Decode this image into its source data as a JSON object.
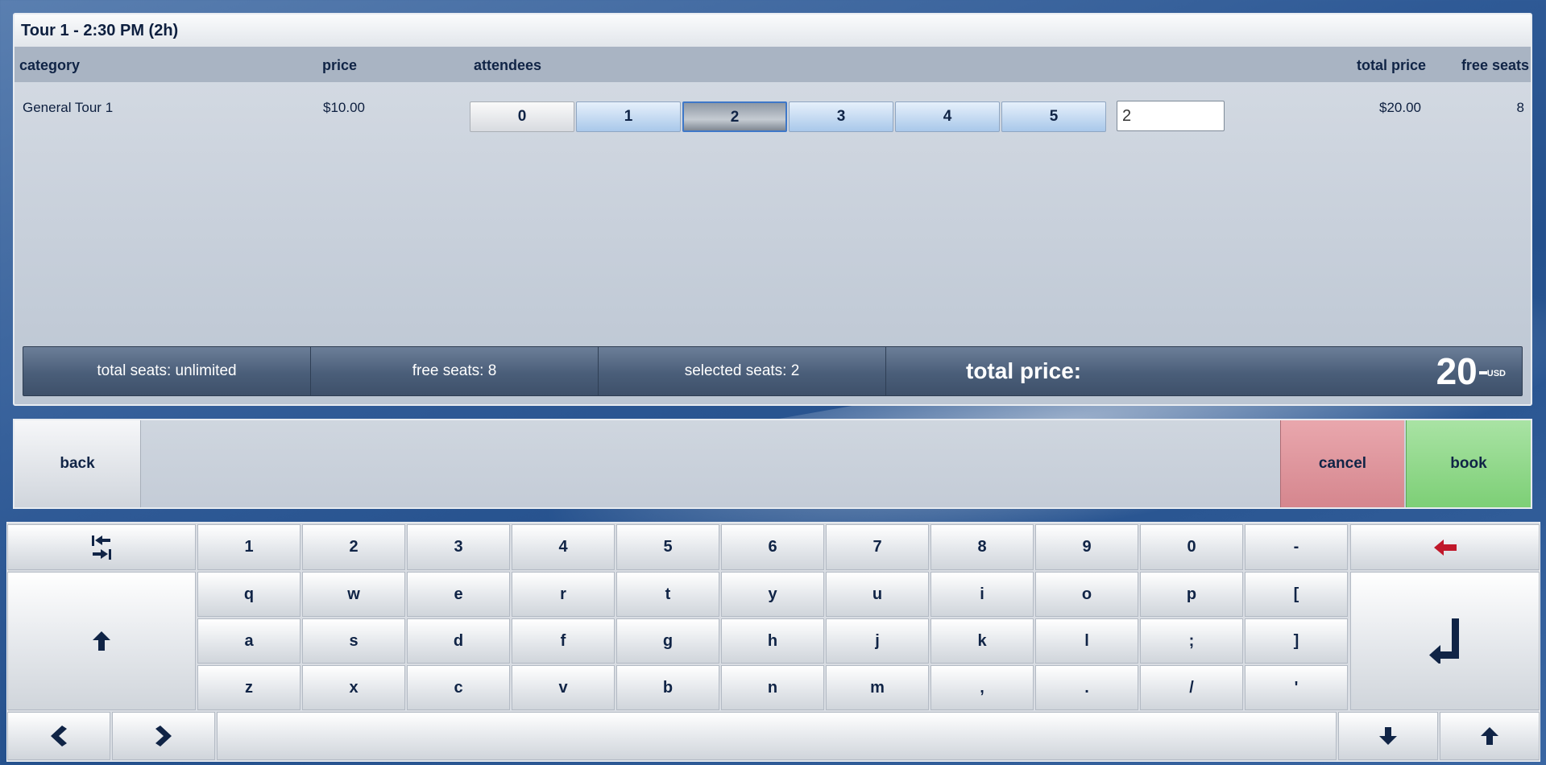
{
  "tour": {
    "title": "Tour 1 - 2:30 PM (2h)"
  },
  "columns": {
    "category": "category",
    "price": "price",
    "attendees": "attendees",
    "total_price": "total price",
    "free_seats": "free seats"
  },
  "row": {
    "category": "General Tour 1",
    "price": "$10.00",
    "attendee_options": [
      "0",
      "1",
      "2",
      "3",
      "4",
      "5"
    ],
    "selected_attendees": "2",
    "attendee_input_value": "2",
    "total_price": "$20.00",
    "free_seats": "8"
  },
  "summary": {
    "total_seats": "total seats: unlimited",
    "free_seats": "free seats: 8",
    "selected_seats": "selected seats: 2",
    "total_price_label": "total price:",
    "amount": "20",
    "currency": "USD"
  },
  "actions": {
    "back": "back",
    "cancel": "cancel",
    "book": "book"
  },
  "keyboard": {
    "row_numbers": [
      "1",
      "2",
      "3",
      "4",
      "5",
      "6",
      "7",
      "8",
      "9",
      "0",
      "-"
    ],
    "row_q": [
      "q",
      "w",
      "e",
      "r",
      "t",
      "y",
      "u",
      "i",
      "o",
      "p",
      "["
    ],
    "row_a": [
      "a",
      "s",
      "d",
      "f",
      "g",
      "h",
      "j",
      "k",
      "l",
      ";",
      "]"
    ],
    "row_z": [
      "z",
      "x",
      "c",
      "v",
      "b",
      "n",
      "m",
      ",",
      ".",
      "/",
      "'"
    ],
    "icons": {
      "tab": "tab-icon",
      "backspace": "backspace-arrow-icon",
      "shift": "shift-up-arrow-icon",
      "enter": "enter-return-icon",
      "left": "chevron-left-icon",
      "right": "chevron-right-icon",
      "down": "arrow-down-icon",
      "up": "arrow-up-icon"
    }
  },
  "colors": {
    "accent_selected": "#3f78c8",
    "cancel": "#d5868e",
    "book": "#7dcf76",
    "backspace_icon": "#c0182a",
    "text_dark": "#102446"
  }
}
